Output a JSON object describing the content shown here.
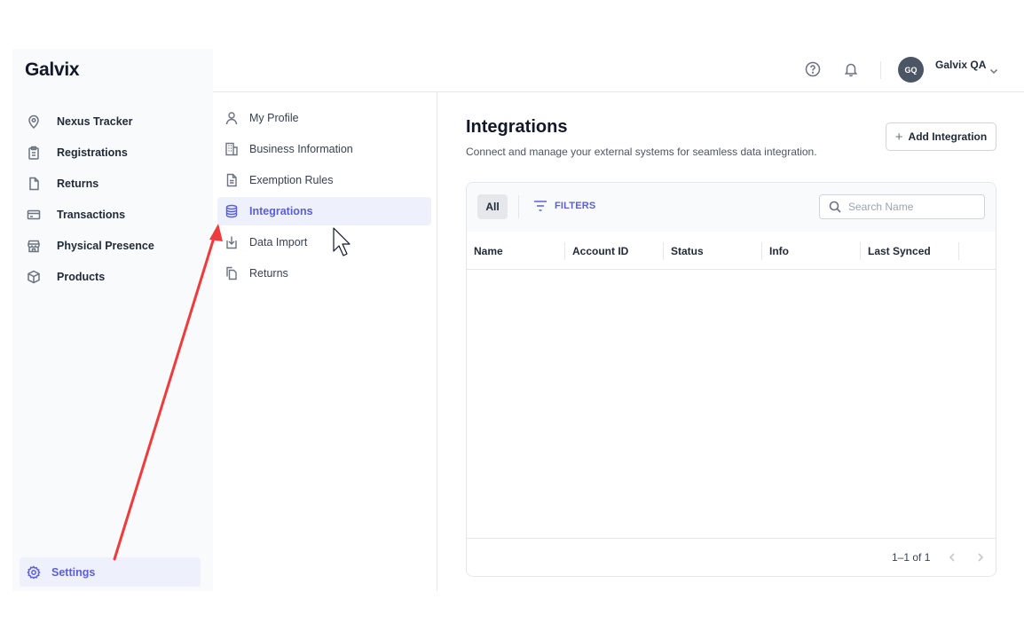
{
  "app": {
    "logo": "Galvix"
  },
  "sidebar": {
    "items": [
      {
        "label": "Nexus Tracker",
        "icon": "location-pin-icon"
      },
      {
        "label": "Registrations",
        "icon": "clipboard-icon"
      },
      {
        "label": "Returns",
        "icon": "document-icon"
      },
      {
        "label": "Transactions",
        "icon": "credit-card-icon"
      },
      {
        "label": "Physical Presence",
        "icon": "storefront-icon"
      },
      {
        "label": "Products",
        "icon": "box-icon"
      }
    ],
    "settings_label": "Settings"
  },
  "topbar": {
    "help_icon": "help-circle-icon",
    "bell_icon": "bell-icon",
    "avatar_initials": "GQ",
    "username": "Galvix QA"
  },
  "settings_menu": {
    "items": [
      {
        "label": "My Profile",
        "icon": "user-icon"
      },
      {
        "label": "Business Information",
        "icon": "building-icon"
      },
      {
        "label": "Exemption Rules",
        "icon": "file-text-icon"
      },
      {
        "label": "Integrations",
        "icon": "database-icon",
        "active": true
      },
      {
        "label": "Data Import",
        "icon": "import-icon"
      },
      {
        "label": "Returns",
        "icon": "copy-icon"
      }
    ]
  },
  "main": {
    "title": "Integrations",
    "subtitle": "Connect and manage your external systems for seamless data integration.",
    "add_button": "Add Integration",
    "toolbar": {
      "all_label": "All",
      "filters_label": "FILTERS",
      "search_placeholder": "Search Name"
    },
    "table": {
      "columns": [
        "Name",
        "Account ID",
        "Status",
        "Info",
        "Last Synced"
      ],
      "rows": []
    },
    "pagination": {
      "text": "1–1 of 1"
    }
  },
  "colors": {
    "accent": "#5b5fd6",
    "active_bg": "#eef0fb",
    "annotation_arrow": "#ef3b3b"
  }
}
